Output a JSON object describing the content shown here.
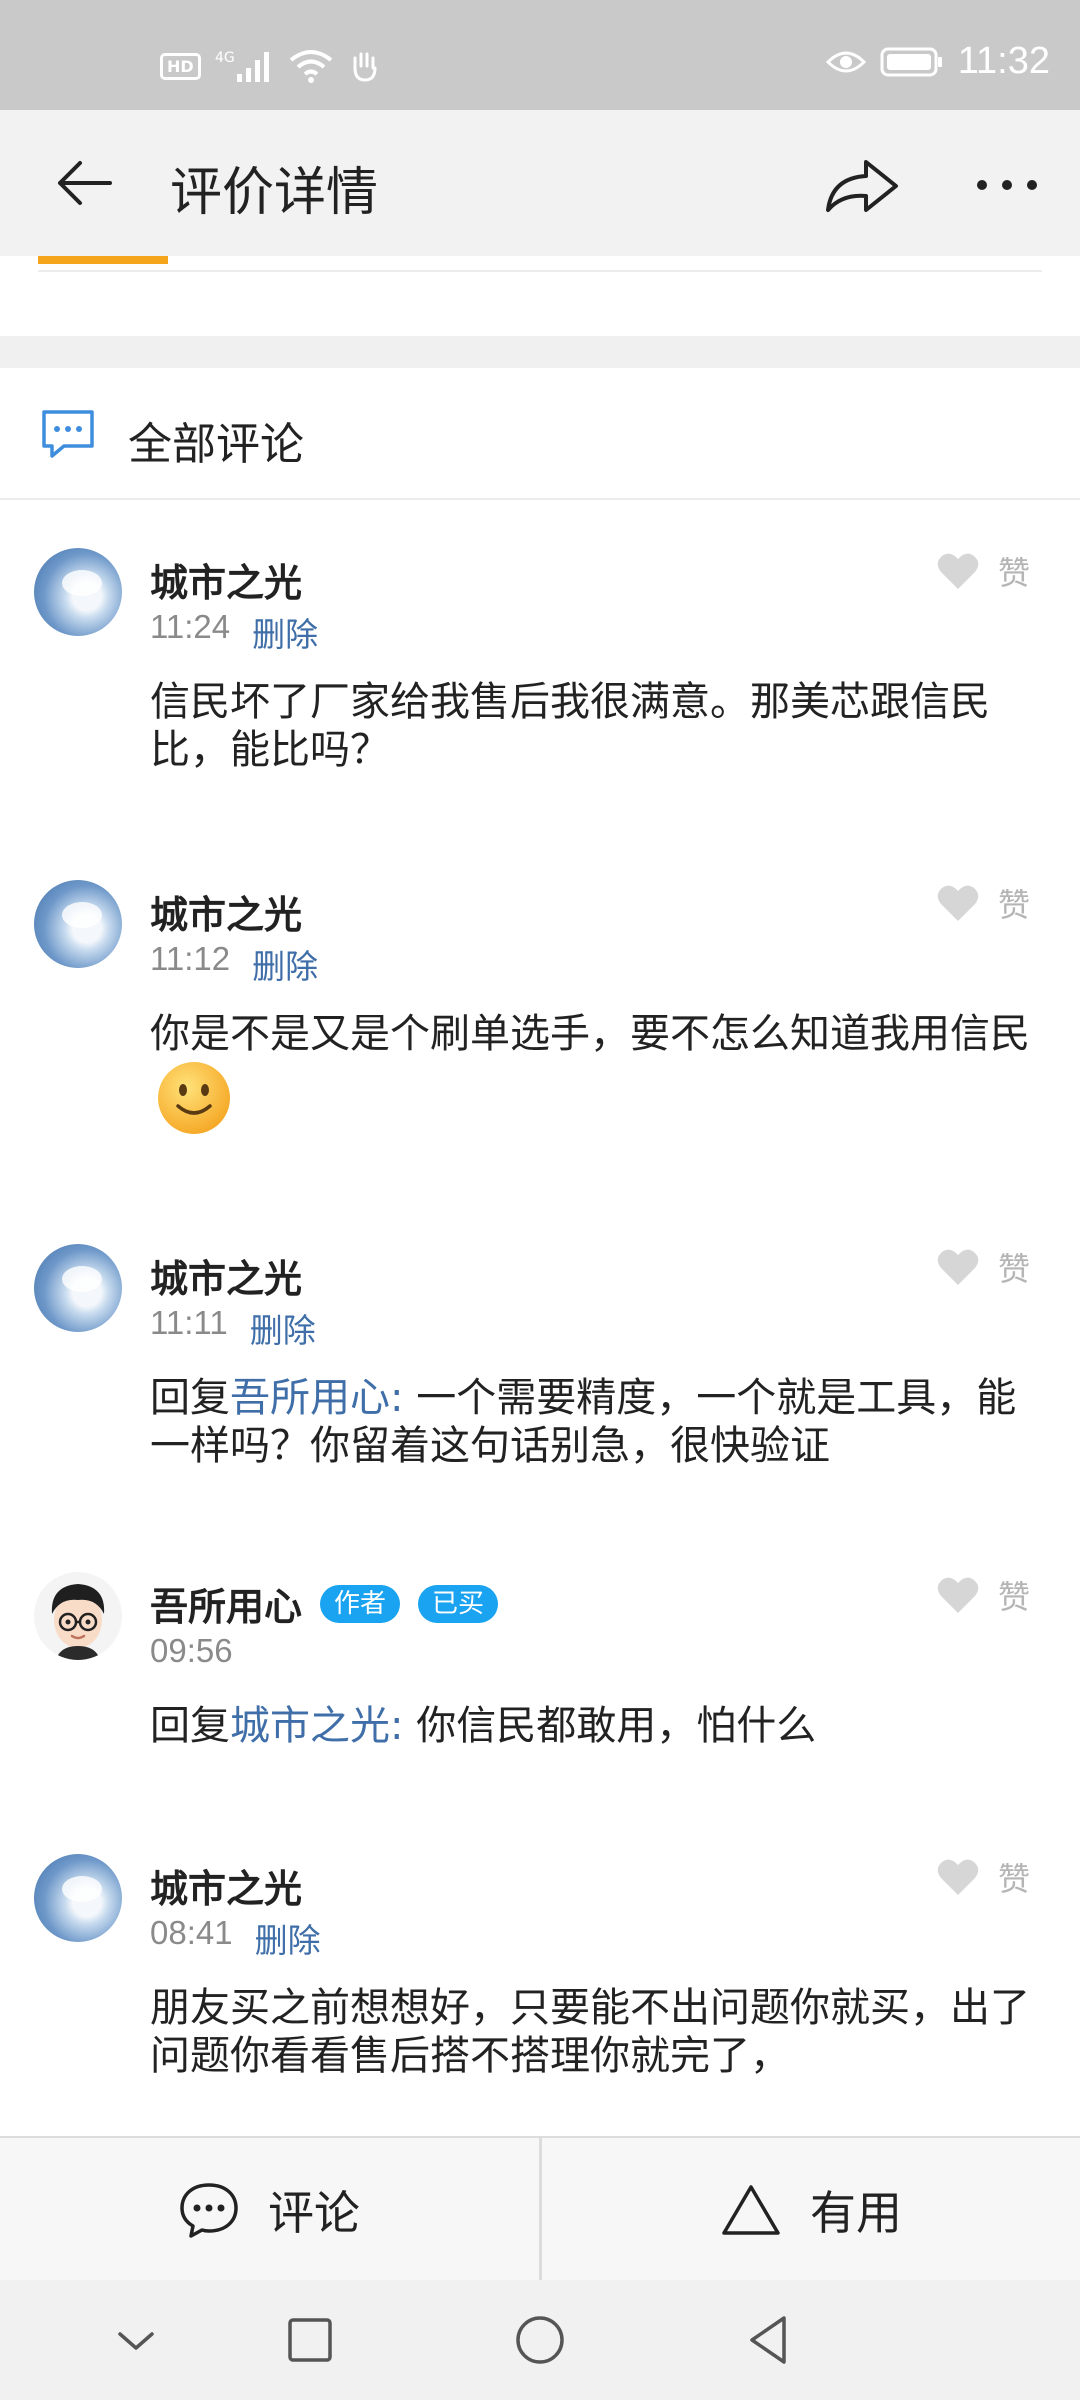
{
  "status_bar": {
    "time": "11:32",
    "hd_label": "HD",
    "network_label": "4G"
  },
  "header": {
    "title": "评价详情"
  },
  "section": {
    "all_comments_label": "全部评论"
  },
  "comments": [
    {
      "username": "城市之光",
      "time": "11:24",
      "delete_label": "删除",
      "like_label": "赞",
      "text": "信民坏了厂家给我售后我很满意。那美芯跟信民比，能比吗？"
    },
    {
      "username": "城市之光",
      "time": "11:12",
      "delete_label": "删除",
      "like_label": "赞",
      "text": "你是不是又是个刷单选手，要不怎么知道我用信民"
    },
    {
      "username": "城市之光",
      "time": "11:11",
      "delete_label": "删除",
      "like_label": "赞",
      "reply_prefix": "回复",
      "reply_to": "吾所用心:",
      "text": " 一个需要精度，一个就是工具，能一样吗？你留着这句话别急，很快验证"
    },
    {
      "username": "吾所用心",
      "time": "09:56",
      "badge_author": "作者",
      "badge_bought": "已买",
      "like_label": "赞",
      "reply_prefix": "回复",
      "reply_to": "城市之光:",
      "text": " 你信民都敢用，怕什么"
    },
    {
      "username": "城市之光",
      "time": "08:41",
      "delete_label": "删除",
      "like_label": "赞",
      "text": "朋友买之前想想好，只要能不出问题你就买，出了问题你看看售后搭不搭理你就完了，"
    }
  ],
  "action_bar": {
    "comment_label": "评论",
    "useful_label": "有用"
  },
  "icons": {
    "back": "arrow-left-icon",
    "share": "share-icon",
    "more": "more-icon",
    "comment": "chat-bubble-icon",
    "useful": "triangle-icon",
    "heart": "heart-icon"
  },
  "colors": {
    "link_blue": "#3f6ea8",
    "badge_blue": "#1aa3f0",
    "status_bar_bg": "#c9c9c9",
    "appbar_bg": "#f2f2f2"
  }
}
